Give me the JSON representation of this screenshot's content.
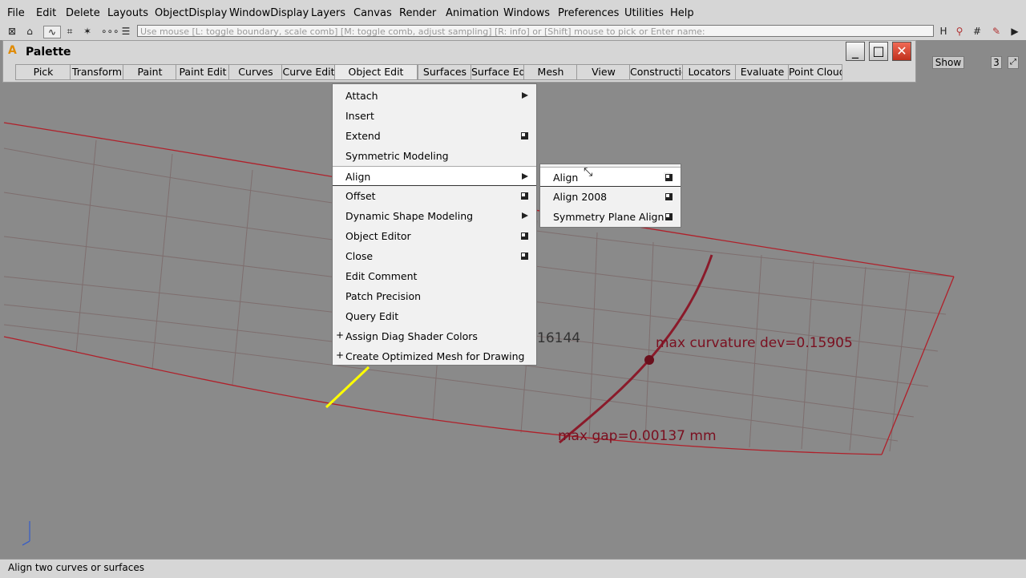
{
  "menubar": {
    "items": [
      "File",
      "Edit",
      "Delete",
      "Layouts",
      "ObjectDisplay",
      "WindowDisplay",
      "Layers",
      "Canvas",
      "Render",
      "Animation",
      "Windows",
      "Preferences",
      "Utilities",
      "Help"
    ]
  },
  "command_line": {
    "placeholder": "Use mouse [L: toggle boundary, scale comb] [M: toggle comb, adjust sampling] [R: info] or [Shift] mouse to pick or Enter name:"
  },
  "palette": {
    "title": "Palette",
    "tabs": [
      "Pick",
      "Transform",
      "Paint",
      "Paint Edit",
      "Curves",
      "Curve Edit",
      "Object Edit",
      "Surfaces",
      "Surface Edit",
      "Mesh",
      "View",
      "Construction",
      "Locators",
      "Evaluate",
      "Point Clouds"
    ],
    "active_tab": "Object Edit"
  },
  "right_panel": {
    "show_label": "Show",
    "number": "3"
  },
  "object_edit_menu": {
    "items": [
      {
        "label": "Attach",
        "kind": "submenu"
      },
      {
        "label": "Insert",
        "kind": "plain"
      },
      {
        "label": "Extend",
        "kind": "option"
      },
      {
        "label": "Symmetric Modeling",
        "kind": "plain"
      },
      {
        "label": "Align",
        "kind": "submenu"
      },
      {
        "label": "Offset",
        "kind": "option"
      },
      {
        "label": "Dynamic Shape Modeling",
        "kind": "submenu"
      },
      {
        "label": "Object Editor",
        "kind": "option"
      },
      {
        "label": "Close",
        "kind": "option"
      },
      {
        "label": "Edit Comment",
        "kind": "plain"
      },
      {
        "label": "Patch Precision",
        "kind": "plain"
      },
      {
        "label": "Query Edit",
        "kind": "plain"
      },
      {
        "label": "Assign Diag Shader Colors",
        "kind": "plus"
      },
      {
        "label": "Create Optimized Mesh for Drawing",
        "kind": "plus"
      }
    ],
    "highlighted": "Align"
  },
  "align_submenu": {
    "items": [
      {
        "label": "Align",
        "kind": "option"
      },
      {
        "label": "Align 2008",
        "kind": "option"
      },
      {
        "label": "Symmetry Plane Align",
        "kind": "option"
      }
    ],
    "highlighted": "Align"
  },
  "viewport": {
    "annotation_partial": "16144",
    "annotation_curvature": "max curvature dev=0.15905",
    "annotation_gap": "max gap=0.00137 mm",
    "colors": {
      "curve": "#b0202a",
      "mesh": "#7e6e6e",
      "highlight": "#ffff00",
      "annotation": "#7a1020"
    }
  },
  "status": {
    "text": "Align two curves or surfaces"
  }
}
